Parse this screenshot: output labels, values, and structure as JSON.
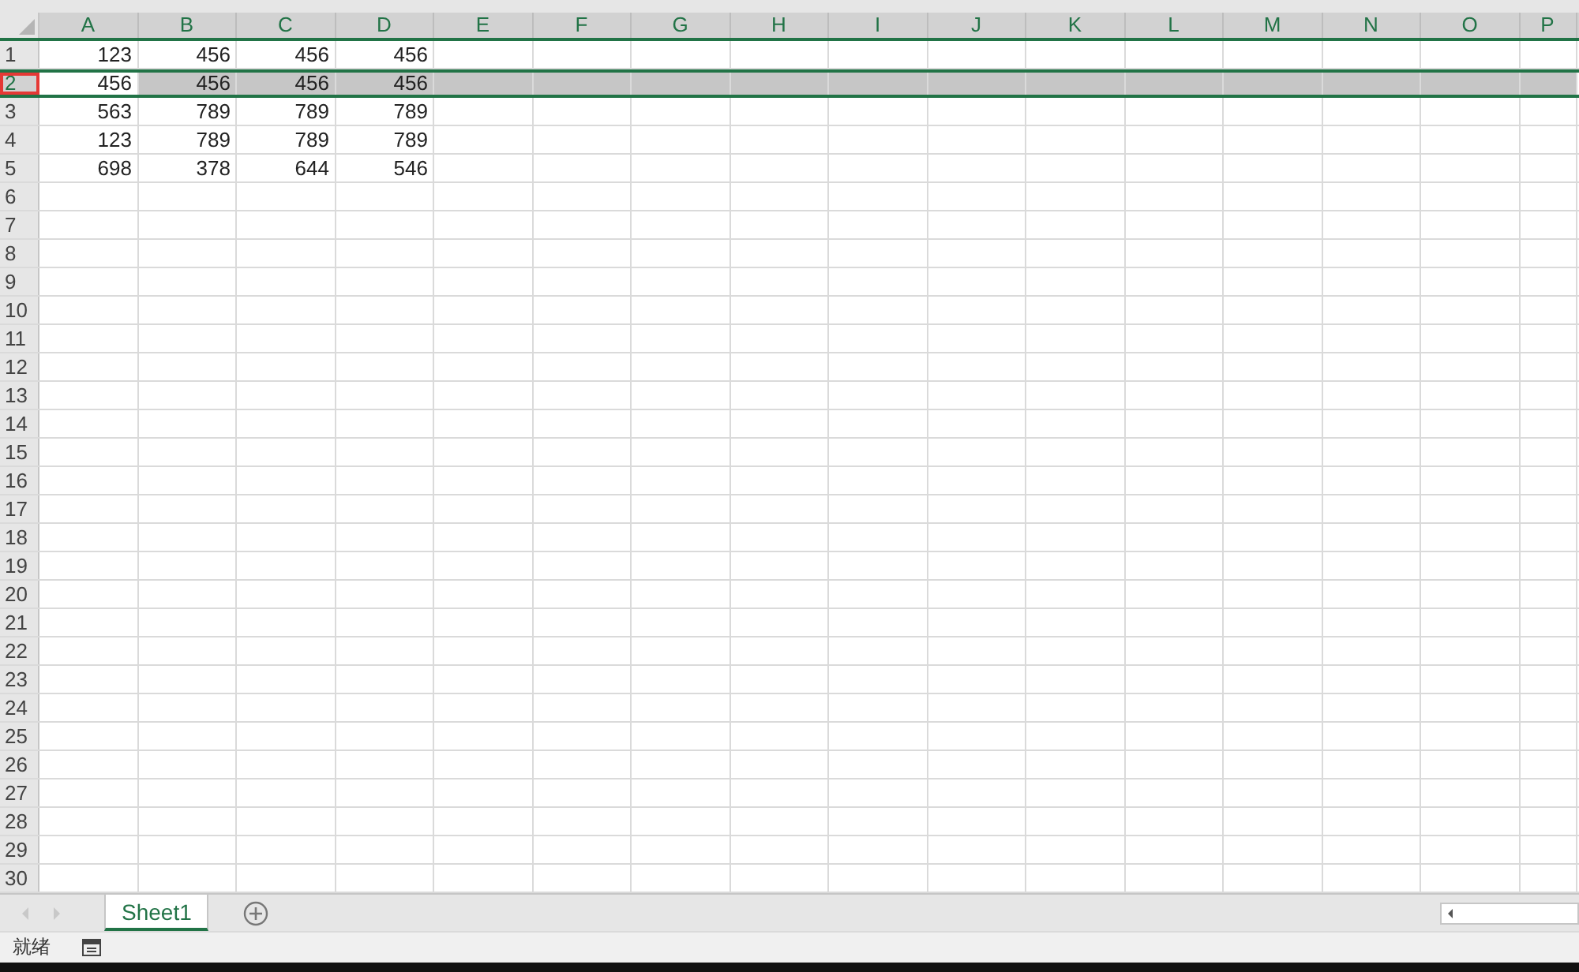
{
  "columns": [
    "A",
    "B",
    "C",
    "D",
    "E",
    "F",
    "G",
    "H",
    "I",
    "J",
    "K",
    "L",
    "M",
    "N",
    "O",
    "P"
  ],
  "rows": [
    {
      "label": "1",
      "selected": false,
      "annotated": false,
      "cells": [
        "123",
        "456",
        "456",
        "456"
      ]
    },
    {
      "label": "2",
      "selected": true,
      "annotated": true,
      "cells": [
        "456",
        "456",
        "456",
        "456"
      ]
    },
    {
      "label": "3",
      "selected": false,
      "annotated": false,
      "cells": [
        "563",
        "789",
        "789",
        "789"
      ]
    },
    {
      "label": "4",
      "selected": false,
      "annotated": false,
      "cells": [
        "123",
        "789",
        "789",
        "789"
      ]
    },
    {
      "label": "5",
      "selected": false,
      "annotated": false,
      "cells": [
        "698",
        "378",
        "644",
        "546"
      ]
    },
    {
      "label": "6",
      "selected": false,
      "annotated": false
    },
    {
      "label": "7",
      "selected": false,
      "annotated": false
    },
    {
      "label": "8",
      "selected": false,
      "annotated": false
    },
    {
      "label": "9",
      "selected": false,
      "annotated": false
    },
    {
      "label": "10",
      "selected": false,
      "annotated": false
    },
    {
      "label": "11",
      "selected": false,
      "annotated": false
    },
    {
      "label": "12",
      "selected": false,
      "annotated": false
    },
    {
      "label": "13",
      "selected": false,
      "annotated": false
    },
    {
      "label": "14",
      "selected": false,
      "annotated": false
    },
    {
      "label": "15",
      "selected": false,
      "annotated": false
    },
    {
      "label": "16",
      "selected": false,
      "annotated": false
    },
    {
      "label": "17",
      "selected": false,
      "annotated": false
    },
    {
      "label": "18",
      "selected": false,
      "annotated": false
    },
    {
      "label": "19",
      "selected": false,
      "annotated": false
    },
    {
      "label": "20",
      "selected": false,
      "annotated": false
    },
    {
      "label": "21",
      "selected": false,
      "annotated": false
    },
    {
      "label": "22",
      "selected": false,
      "annotated": false
    },
    {
      "label": "23",
      "selected": false,
      "annotated": false
    },
    {
      "label": "24",
      "selected": false,
      "annotated": false
    },
    {
      "label": "25",
      "selected": false,
      "annotated": false
    },
    {
      "label": "26",
      "selected": false,
      "annotated": false
    },
    {
      "label": "27",
      "selected": false,
      "annotated": false
    },
    {
      "label": "28",
      "selected": false,
      "annotated": false
    },
    {
      "label": "29",
      "selected": false,
      "annotated": false
    },
    {
      "label": "30",
      "selected": false,
      "annotated": false
    }
  ],
  "sheet_tabs": [
    {
      "label": "Sheet1",
      "selected": true
    }
  ],
  "status_bar": {
    "text": "就绪"
  }
}
